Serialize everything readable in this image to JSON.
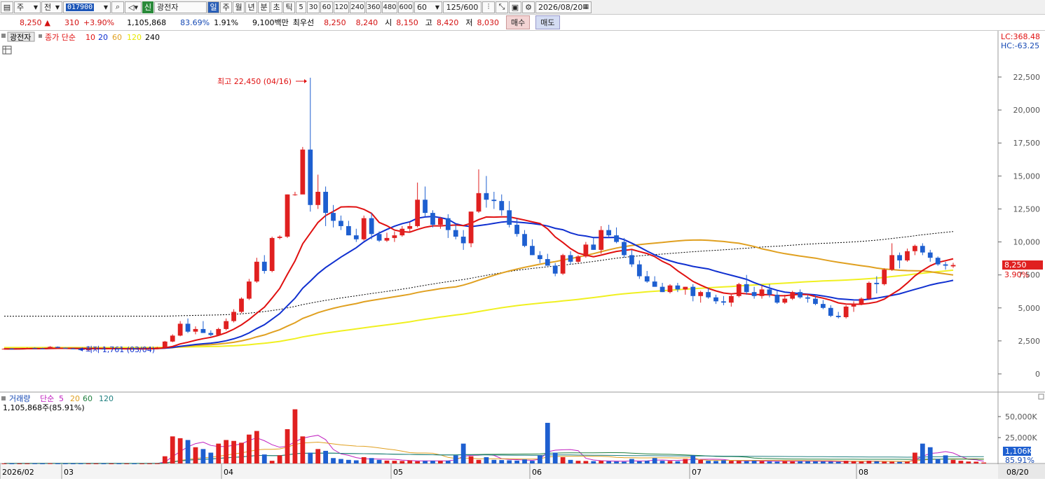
{
  "toolbar": {
    "market": "주",
    "prev": "전",
    "code": "017900",
    "badge": "신",
    "stock_name": "광전자",
    "period_day": "일",
    "period_week": "주",
    "period_month": "월",
    "period_year": "년",
    "period_min": "분",
    "period_sec": "초",
    "period_tick": "틱",
    "intervals": [
      "5",
      "30",
      "60",
      "120",
      "240",
      "360",
      "480",
      "600"
    ],
    "interval_selected": "60",
    "count": "125/600",
    "date": "2026/08/20"
  },
  "quote": {
    "price": "8,250",
    "arrow": "▲",
    "change": "310",
    "change_pct": "+3.90%",
    "volume": "1,105,868",
    "ratio": "83.69%",
    "turnover": "1.91%",
    "amount": "9,100백만",
    "best_label": "최우선",
    "best_ask": "8,250",
    "best_bid": "8,240",
    "open_label": "시",
    "open": "8,150",
    "high_label": "고",
    "high": "8,420",
    "low_label": "저",
    "low": "8,030",
    "buy_label": "매수",
    "sell_label": "매도"
  },
  "price_panel": {
    "name_tag": "광전자",
    "ma_title": "종가 단순",
    "ma_periods": [
      "10",
      "20",
      "60",
      "120",
      "240"
    ],
    "lc": "LC:368.48",
    "hc": "HC:-63.25",
    "high_annot": "최고 22,450 (04/16)",
    "low_annot": "최저 1,761 (03/04)",
    "current_price": "8,250",
    "current_pct": "3.90%",
    "yticks": [
      "22,500",
      "20,000",
      "17,500",
      "15,000",
      "12,500",
      "10,000",
      "7,500",
      "5,000",
      "2,500",
      "0"
    ]
  },
  "volume_panel": {
    "title": "거래량",
    "ma_title": "단순",
    "ma_periods": [
      "5",
      "20",
      "60",
      "120"
    ],
    "current": "1,105,868주(85.91%)",
    "yticks": [
      "50,000K",
      "25,000K"
    ],
    "cur_value": "1,106K",
    "cur_pct": "85.91%"
  },
  "x_axis": {
    "labels": [
      "2026/02",
      "03",
      "04",
      "05",
      "06",
      "07",
      "08",
      "08/20"
    ]
  },
  "colors": {
    "up": "#e02020",
    "down": "#1e5fd0",
    "ma10": "#e01010",
    "ma20": "#1030d0",
    "ma60": "#e0a020",
    "ma120": "#f0f020",
    "ma240": "#000000"
  },
  "chart_data": {
    "type": "candlestick",
    "ylim": [
      0,
      24000
    ],
    "ohlc": [
      [
        1900,
        1950,
        1850,
        1900
      ],
      [
        1900,
        1950,
        1850,
        1880
      ],
      [
        1880,
        1950,
        1840,
        1920
      ],
      [
        1920,
        2000,
        1880,
        1950
      ],
      [
        1950,
        2000,
        1900,
        1920
      ],
      [
        1920,
        1980,
        1880,
        1900
      ],
      [
        1900,
        2100,
        1880,
        2050
      ],
      [
        2050,
        2080,
        1950,
        1980
      ],
      [
        1980,
        2000,
        1900,
        1920
      ],
      [
        1920,
        1960,
        1880,
        1900
      ],
      [
        1900,
        1940,
        1761,
        1800
      ],
      [
        1800,
        1900,
        1780,
        1880
      ],
      [
        1880,
        1920,
        1850,
        1900
      ],
      [
        1900,
        1940,
        1860,
        1890
      ],
      [
        1890,
        1930,
        1860,
        1910
      ],
      [
        1910,
        1950,
        1880,
        1900
      ],
      [
        1900,
        1940,
        1870,
        1920
      ],
      [
        1920,
        1960,
        1890,
        1910
      ],
      [
        1910,
        1950,
        1880,
        1930
      ],
      [
        1930,
        2000,
        1900,
        1980
      ],
      [
        1980,
        2050,
        1950,
        2000
      ],
      [
        2000,
        2500,
        1980,
        2450
      ],
      [
        2450,
        3000,
        2400,
        2900
      ],
      [
        2900,
        4000,
        2850,
        3800
      ],
      [
        3800,
        4200,
        3100,
        3200
      ],
      [
        3200,
        3600,
        3000,
        3400
      ],
      [
        3400,
        4000,
        3200,
        3100
      ],
      [
        3100,
        3300,
        2850,
        2950
      ],
      [
        2950,
        3500,
        2900,
        3400
      ],
      [
        3400,
        4200,
        3300,
        4000
      ],
      [
        4000,
        4900,
        3900,
        4700
      ],
      [
        4700,
        5800,
        4600,
        5700
      ],
      [
        5700,
        7200,
        5600,
        7000
      ],
      [
        7000,
        8800,
        6900,
        8500
      ],
      [
        8500,
        9000,
        7600,
        7800
      ],
      [
        7800,
        10400,
        7700,
        10300
      ],
      [
        10300,
        10500,
        10200,
        10400
      ],
      [
        10400,
        13600,
        10300,
        13600
      ],
      [
        13600,
        13800,
        13500,
        13600
      ],
      [
        13600,
        17200,
        15100,
        17000
      ],
      [
        17000,
        22450,
        12300,
        12800
      ],
      [
        12800,
        15100,
        12500,
        13800
      ],
      [
        13800,
        14200,
        11200,
        12200
      ],
      [
        12200,
        12800,
        11100,
        11600
      ],
      [
        11600,
        12000,
        10900,
        11200
      ],
      [
        11200,
        11600,
        10500,
        10500
      ],
      [
        10500,
        11000,
        10000,
        10200
      ],
      [
        10200,
        12000,
        10100,
        11800
      ],
      [
        11800,
        12200,
        10200,
        10600
      ],
      [
        10600,
        10800,
        10000,
        10100
      ],
      [
        10100,
        10700,
        10000,
        10300
      ],
      [
        10300,
        10800,
        10000,
        10500
      ],
      [
        10500,
        11200,
        10400,
        11000
      ],
      [
        11000,
        11500,
        10700,
        11200
      ],
      [
        11200,
        14500,
        11100,
        13200
      ],
      [
        13200,
        14200,
        11900,
        12200
      ],
      [
        12200,
        12400,
        11100,
        11300
      ],
      [
        11300,
        11900,
        11000,
        11800
      ],
      [
        11800,
        12100,
        10300,
        10900
      ],
      [
        10900,
        11400,
        10200,
        10400
      ],
      [
        10400,
        10900,
        9400,
        9900
      ],
      [
        9900,
        12300,
        9600,
        12300
      ],
      [
        12300,
        15500,
        12200,
        13700
      ],
      [
        13700,
        15000,
        12600,
        13200
      ],
      [
        13200,
        13800,
        12500,
        13100
      ],
      [
        13100,
        13600,
        12000,
        12400
      ],
      [
        12400,
        13100,
        11100,
        11300
      ],
      [
        11300,
        11800,
        10400,
        10600
      ],
      [
        10600,
        10900,
        9600,
        9700
      ],
      [
        9700,
        10200,
        9000,
        9000
      ],
      [
        9000,
        9300,
        8400,
        8700
      ],
      [
        8700,
        9100,
        8300,
        8200
      ],
      [
        8200,
        8400,
        7400,
        7600
      ],
      [
        7600,
        9100,
        7500,
        9000
      ],
      [
        9000,
        9300,
        8300,
        8500
      ],
      [
        8500,
        9000,
        8400,
        8900
      ],
      [
        8900,
        10000,
        8800,
        9800
      ],
      [
        9800,
        10300,
        9400,
        9400
      ],
      [
        9400,
        11200,
        9100,
        10900
      ],
      [
        10900,
        11300,
        10400,
        10500
      ],
      [
        10500,
        11100,
        9900,
        10000
      ],
      [
        10000,
        10300,
        8800,
        9000
      ],
      [
        9000,
        9400,
        8100,
        8300
      ],
      [
        8300,
        8600,
        7200,
        7400
      ],
      [
        7400,
        7800,
        6900,
        7000
      ],
      [
        7000,
        7400,
        6600,
        6600
      ],
      [
        6600,
        6900,
        6200,
        6200
      ],
      [
        6200,
        6800,
        6100,
        6700
      ],
      [
        6700,
        6900,
        6200,
        6400
      ],
      [
        6400,
        6600,
        6000,
        6600
      ],
      [
        6600,
        6800,
        5500,
        5900
      ],
      [
        5900,
        6300,
        5400,
        6200
      ],
      [
        6200,
        6500,
        5700,
        5800
      ],
      [
        5800,
        6000,
        5300,
        5500
      ],
      [
        5500,
        5900,
        5200,
        5400
      ],
      [
        5400,
        6000,
        5100,
        5900
      ],
      [
        5900,
        6900,
        5800,
        6800
      ],
      [
        6800,
        7500,
        6000,
        6200
      ],
      [
        6200,
        6600,
        5700,
        5900
      ],
      [
        5900,
        6700,
        5700,
        6400
      ],
      [
        6400,
        6800,
        5800,
        6000
      ],
      [
        6000,
        6300,
        5300,
        5400
      ],
      [
        5400,
        6000,
        5300,
        5700
      ],
      [
        5700,
        6300,
        5600,
        6200
      ],
      [
        6200,
        6400,
        5700,
        5800
      ],
      [
        5800,
        6000,
        5400,
        5700
      ],
      [
        5700,
        6000,
        5200,
        5300
      ],
      [
        5300,
        5600,
        4900,
        5000
      ],
      [
        5000,
        5200,
        4300,
        4400
      ],
      [
        4400,
        4700,
        4200,
        4300
      ],
      [
        4300,
        5200,
        4200,
        5100
      ],
      [
        5100,
        5500,
        4700,
        5300
      ],
      [
        5300,
        5800,
        5200,
        5700
      ],
      [
        5700,
        7000,
        5600,
        6900
      ],
      [
        6900,
        7400,
        6100,
        6800
      ],
      [
        6800,
        8000,
        6700,
        7900
      ],
      [
        7900,
        9900,
        7800,
        9000
      ],
      [
        9000,
        9200,
        8000,
        8600
      ],
      [
        8600,
        9500,
        8500,
        9300
      ],
      [
        9300,
        9800,
        9000,
        9700
      ],
      [
        9700,
        9900,
        9000,
        9200
      ],
      [
        9200,
        9400,
        8500,
        8800
      ],
      [
        8800,
        8900,
        8200,
        8300
      ],
      [
        8300,
        8500,
        7900,
        8200
      ],
      [
        8150,
        8420,
        8030,
        8250
      ]
    ],
    "volume": [
      60,
      50,
      40,
      70,
      90,
      50,
      200,
      60,
      40,
      30,
      80,
      50,
      40,
      35,
      30,
      45,
      30,
      40,
      35,
      60,
      120,
      8000,
      30000,
      28000,
      26000,
      18000,
      16000,
      12000,
      22000,
      26000,
      25000,
      23000,
      32000,
      36000,
      10000,
      3000,
      9000,
      38000,
      60000,
      30000,
      12000,
      16000,
      14000,
      6000,
      5000,
      4000,
      3500,
      7000,
      6000,
      4000,
      3200,
      3000,
      2800,
      3400,
      2500,
      2800,
      3000,
      2900,
      3000,
      9000,
      22000,
      8000,
      4000,
      7000,
      4000,
      3800,
      3500,
      3200,
      4500,
      3000,
      9000,
      45000,
      12000,
      7000,
      4000,
      3000,
      2800,
      2600,
      3000,
      2500,
      2200,
      2000,
      5000,
      2400,
      3000,
      6000,
      3000,
      2800,
      2500,
      5000,
      9000,
      4000,
      3000,
      2800,
      3500,
      3000,
      2800,
      2600,
      3000,
      2500,
      2200,
      2000,
      2800,
      2400,
      2600,
      2500,
      2300,
      2200,
      2000,
      1800,
      3000,
      2500,
      2200,
      3000,
      2400,
      2000,
      1900,
      1800,
      2000,
      12000,
      22000,
      18000,
      5000,
      9000,
      4000,
      3000,
      2200,
      2000,
      1106
    ]
  }
}
